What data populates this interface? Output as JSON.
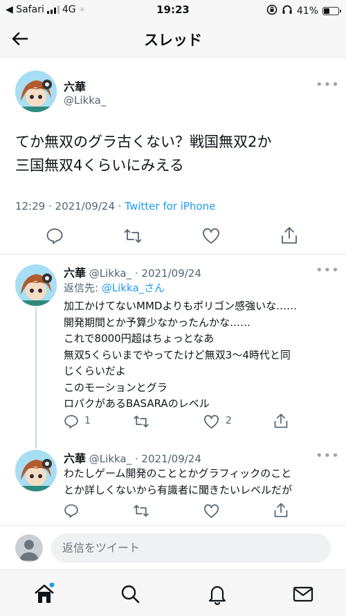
{
  "status_bar": {
    "carrier": "◀ Safari",
    "network": "4G",
    "time": "19:23",
    "battery": "41%",
    "battery_level": 0.41
  },
  "nav": {
    "title": "スレッド"
  },
  "main_tweet": {
    "name": "六華",
    "handle": "@Likka_",
    "more": "•••",
    "text_line1": "てか無双のグラ古くない？戦国無双2か",
    "text_line2": "三国無双4くらいにみえる",
    "meta_time": "12:29 · 2021/09/24 · ",
    "meta_source": "Twitter for iPhone"
  },
  "replies": [
    {
      "name": "六華",
      "handle_date": "@Likka_ · 2021/09/24",
      "more": "•••",
      "reply_prefix": "返信先: ",
      "reply_to": "@Likka_さん",
      "lines": [
        "加工かけてないMMDよりもポリゴン感強いな……",
        "開発期間とか予算少なかったんかな……",
        "これで8000円超はちょっとなあ",
        "無双5くらいまでやってたけど無双3〜4時代と同",
        "じくらいだよ",
        "このモーションとグラ",
        "ロパクがあるBASARAのレベル"
      ],
      "reply_count": "1",
      "like_count": "2"
    },
    {
      "name": "六華",
      "handle_date": "@Likka_ · 2021/09/24",
      "more": "•••",
      "lines": [
        "わたしゲーム開発のこととかグラフィックのこと",
        "とか詳しくないから有識者に聞きたいレベルだが"
      ]
    }
  ],
  "composer": {
    "placeholder": "返信をツイート"
  },
  "colors": {
    "accent": "#1d9bf0",
    "text": "#0f1419",
    "muted": "#536471"
  }
}
